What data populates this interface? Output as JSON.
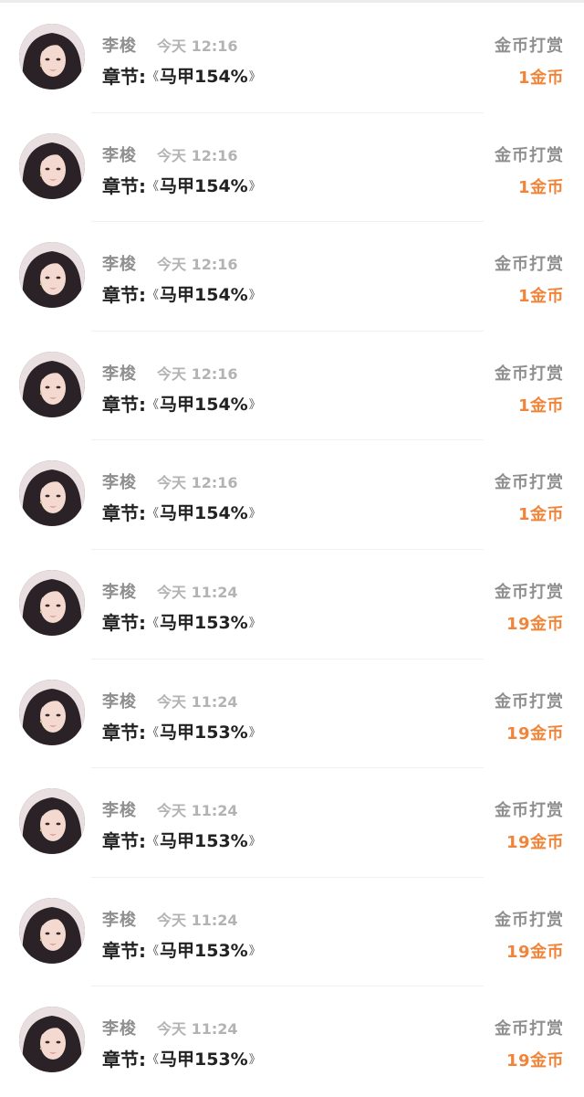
{
  "colors": {
    "name": "#8f8f8f",
    "time": "#b3b3b3",
    "chapter": "#222222",
    "amount": "#f0853a"
  },
  "items": [
    {
      "avatar": "avatar-photo",
      "name": "李梭",
      "time": "今天 12:16",
      "chapter_label": "章节:",
      "book_open": "《",
      "book_title": "马甲154%",
      "book_close": "》",
      "type": "金币打赏",
      "amount": "1金币"
    },
    {
      "avatar": "avatar-photo",
      "name": "李梭",
      "time": "今天 12:16",
      "chapter_label": "章节:",
      "book_open": "《",
      "book_title": "马甲154%",
      "book_close": "》",
      "type": "金币打赏",
      "amount": "1金币"
    },
    {
      "avatar": "avatar-photo",
      "name": "李梭",
      "time": "今天 12:16",
      "chapter_label": "章节:",
      "book_open": "《",
      "book_title": "马甲154%",
      "book_close": "》",
      "type": "金币打赏",
      "amount": "1金币"
    },
    {
      "avatar": "avatar-photo",
      "name": "李梭",
      "time": "今天 12:16",
      "chapter_label": "章节:",
      "book_open": "《",
      "book_title": "马甲154%",
      "book_close": "》",
      "type": "金币打赏",
      "amount": "1金币"
    },
    {
      "avatar": "avatar-photo",
      "name": "李梭",
      "time": "今天 12:16",
      "chapter_label": "章节:",
      "book_open": "《",
      "book_title": "马甲154%",
      "book_close": "》",
      "type": "金币打赏",
      "amount": "1金币"
    },
    {
      "avatar": "avatar-photo",
      "name": "李梭",
      "time": "今天 11:24",
      "chapter_label": "章节:",
      "book_open": "《",
      "book_title": "马甲153%",
      "book_close": "》",
      "type": "金币打赏",
      "amount": "19金币"
    },
    {
      "avatar": "avatar-photo",
      "name": "李梭",
      "time": "今天 11:24",
      "chapter_label": "章节:",
      "book_open": "《",
      "book_title": "马甲153%",
      "book_close": "》",
      "type": "金币打赏",
      "amount": "19金币"
    },
    {
      "avatar": "avatar-photo",
      "name": "李梭",
      "time": "今天 11:24",
      "chapter_label": "章节:",
      "book_open": "《",
      "book_title": "马甲153%",
      "book_close": "》",
      "type": "金币打赏",
      "amount": "19金币"
    },
    {
      "avatar": "avatar-photo",
      "name": "李梭",
      "time": "今天 11:24",
      "chapter_label": "章节:",
      "book_open": "《",
      "book_title": "马甲153%",
      "book_close": "》",
      "type": "金币打赏",
      "amount": "19金币"
    },
    {
      "avatar": "avatar-photo",
      "name": "李梭",
      "time": "今天 11:24",
      "chapter_label": "章节:",
      "book_open": "《",
      "book_title": "马甲153%",
      "book_close": "》",
      "type": "金币打赏",
      "amount": "19金币"
    }
  ]
}
